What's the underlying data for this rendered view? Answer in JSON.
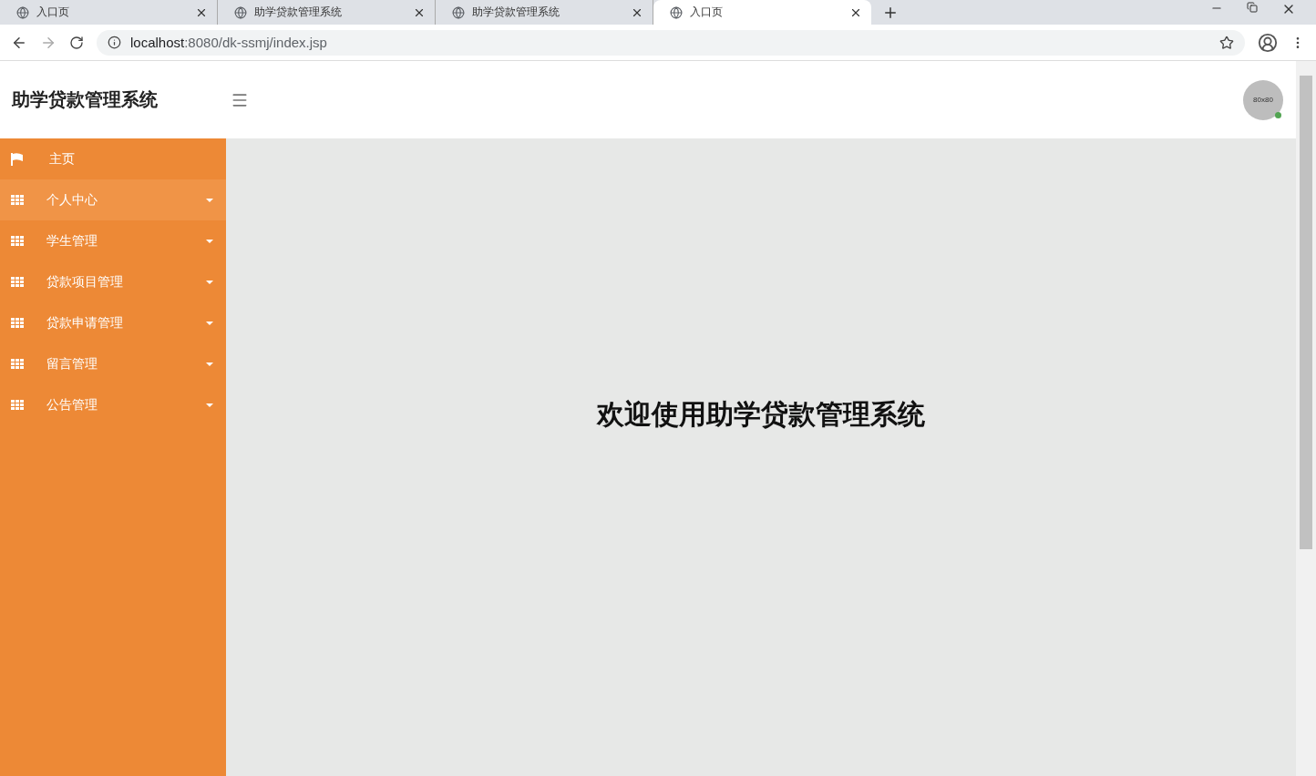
{
  "browser": {
    "tabs": [
      {
        "title": "入口页",
        "selected": false
      },
      {
        "title": "助学贷款管理系统",
        "selected": false
      },
      {
        "title": "助学贷款管理系统",
        "selected": false
      },
      {
        "title": "入口页",
        "selected": true
      }
    ],
    "address": {
      "host": "localhost",
      "rest": ":8080/dk-ssmj/index.jsp"
    }
  },
  "header": {
    "title": "助学贷款管理系统",
    "avatar_text": "80x80",
    "online": true
  },
  "sidebar": {
    "items": [
      {
        "label": "主页",
        "kind": "link",
        "hovered": false
      },
      {
        "label": "个人中心",
        "kind": "menu",
        "hovered": true
      },
      {
        "label": "学生管理",
        "kind": "menu",
        "hovered": false
      },
      {
        "label": "贷款项目管理",
        "kind": "menu",
        "hovered": false
      },
      {
        "label": "贷款申请管理",
        "kind": "menu",
        "hovered": false
      },
      {
        "label": "留言管理",
        "kind": "menu",
        "hovered": false
      },
      {
        "label": "公告管理",
        "kind": "menu",
        "hovered": false
      }
    ]
  },
  "main": {
    "welcome": "欢迎使用助学贷款管理系统"
  }
}
